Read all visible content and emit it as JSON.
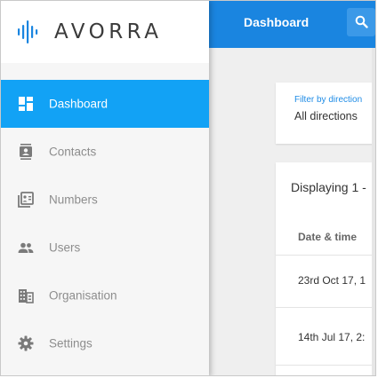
{
  "brand": {
    "name": "AVORRA",
    "logo_icon": "waveform-logo-icon",
    "accent": "#1a85e0"
  },
  "sidebar": {
    "active_color": "#12a2f5",
    "items": [
      {
        "label": "Dashboard",
        "icon": "dashboard-icon",
        "active": true
      },
      {
        "label": "Contacts",
        "icon": "contacts-icon",
        "active": false
      },
      {
        "label": "Numbers",
        "icon": "numbers-icon",
        "active": false
      },
      {
        "label": "Users",
        "icon": "users-icon",
        "active": false
      },
      {
        "label": "Organisation",
        "icon": "organisation-icon",
        "active": false
      },
      {
        "label": "Settings",
        "icon": "gear-icon",
        "active": false
      }
    ]
  },
  "header": {
    "title": "Dashboard",
    "search_icon": "search-icon",
    "color": "#1a85e0"
  },
  "filter": {
    "label": "Filter by direction",
    "value": "All directions"
  },
  "table": {
    "summary": "Displaying 1 -",
    "columns": [
      "Date & time"
    ],
    "rows": [
      {
        "date_time": "23rd Oct 17, 1"
      },
      {
        "date_time": "14th Jul 17, 2:"
      }
    ]
  }
}
